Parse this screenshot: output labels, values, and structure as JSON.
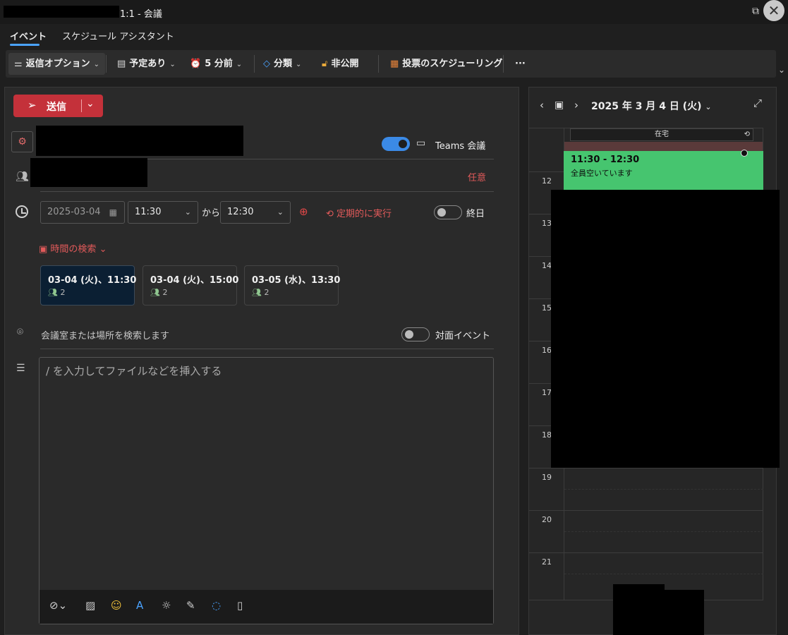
{
  "window": {
    "title": "1:1 - 会議",
    "popout_icon": "popout-icon",
    "close_icon": "close-icon"
  },
  "tabs": [
    {
      "label": "イベント",
      "active": true
    },
    {
      "label": "スケジュール アシスタント",
      "active": false
    }
  ],
  "toolbar": {
    "reply_options": "返信オプション",
    "show_as": "予定あり",
    "reminder": "5 分前",
    "categorize": "分類",
    "private": "非公開",
    "poll": "投票のスケジューリング",
    "more": "···"
  },
  "compose": {
    "send_label": "送信",
    "teams_label": "Teams 会議",
    "teams_enabled": true,
    "optional_label": "任意",
    "date": "2025-03-04",
    "start_time": "11:30",
    "to_label": "から",
    "end_time": "12:30",
    "recurring_label": "定期的に実行",
    "all_day_label": "終日",
    "all_day_enabled": false,
    "find_time_label": "時間の検索",
    "suggestions": [
      {
        "time": "03-04 (火)、11:30",
        "count": "2",
        "selected": true
      },
      {
        "time": "03-04 (火)、15:00",
        "count": "2",
        "selected": false
      },
      {
        "time": "03-05 (水)、13:30",
        "count": "2",
        "selected": false
      }
    ],
    "location_placeholder": "会議室または場所を検索します",
    "in_person_label": "対面イベント",
    "in_person_enabled": false,
    "body_placeholder": "/ を入力してファイルなどを挿入する"
  },
  "calendar": {
    "date_label": "2025 年 3 月 4 日 (火)",
    "all_day_event": "在宅",
    "event_time": "11:30 - 12:30",
    "event_status": "全員空いています",
    "hours": [
      "12",
      "13",
      "14",
      "15",
      "16",
      "17",
      "18",
      "19",
      "20",
      "21"
    ]
  },
  "colors": {
    "accent": "#4aa3ff",
    "send": "#c4313a",
    "event_green": "#46c56f",
    "link_red": "#e25a5a"
  }
}
